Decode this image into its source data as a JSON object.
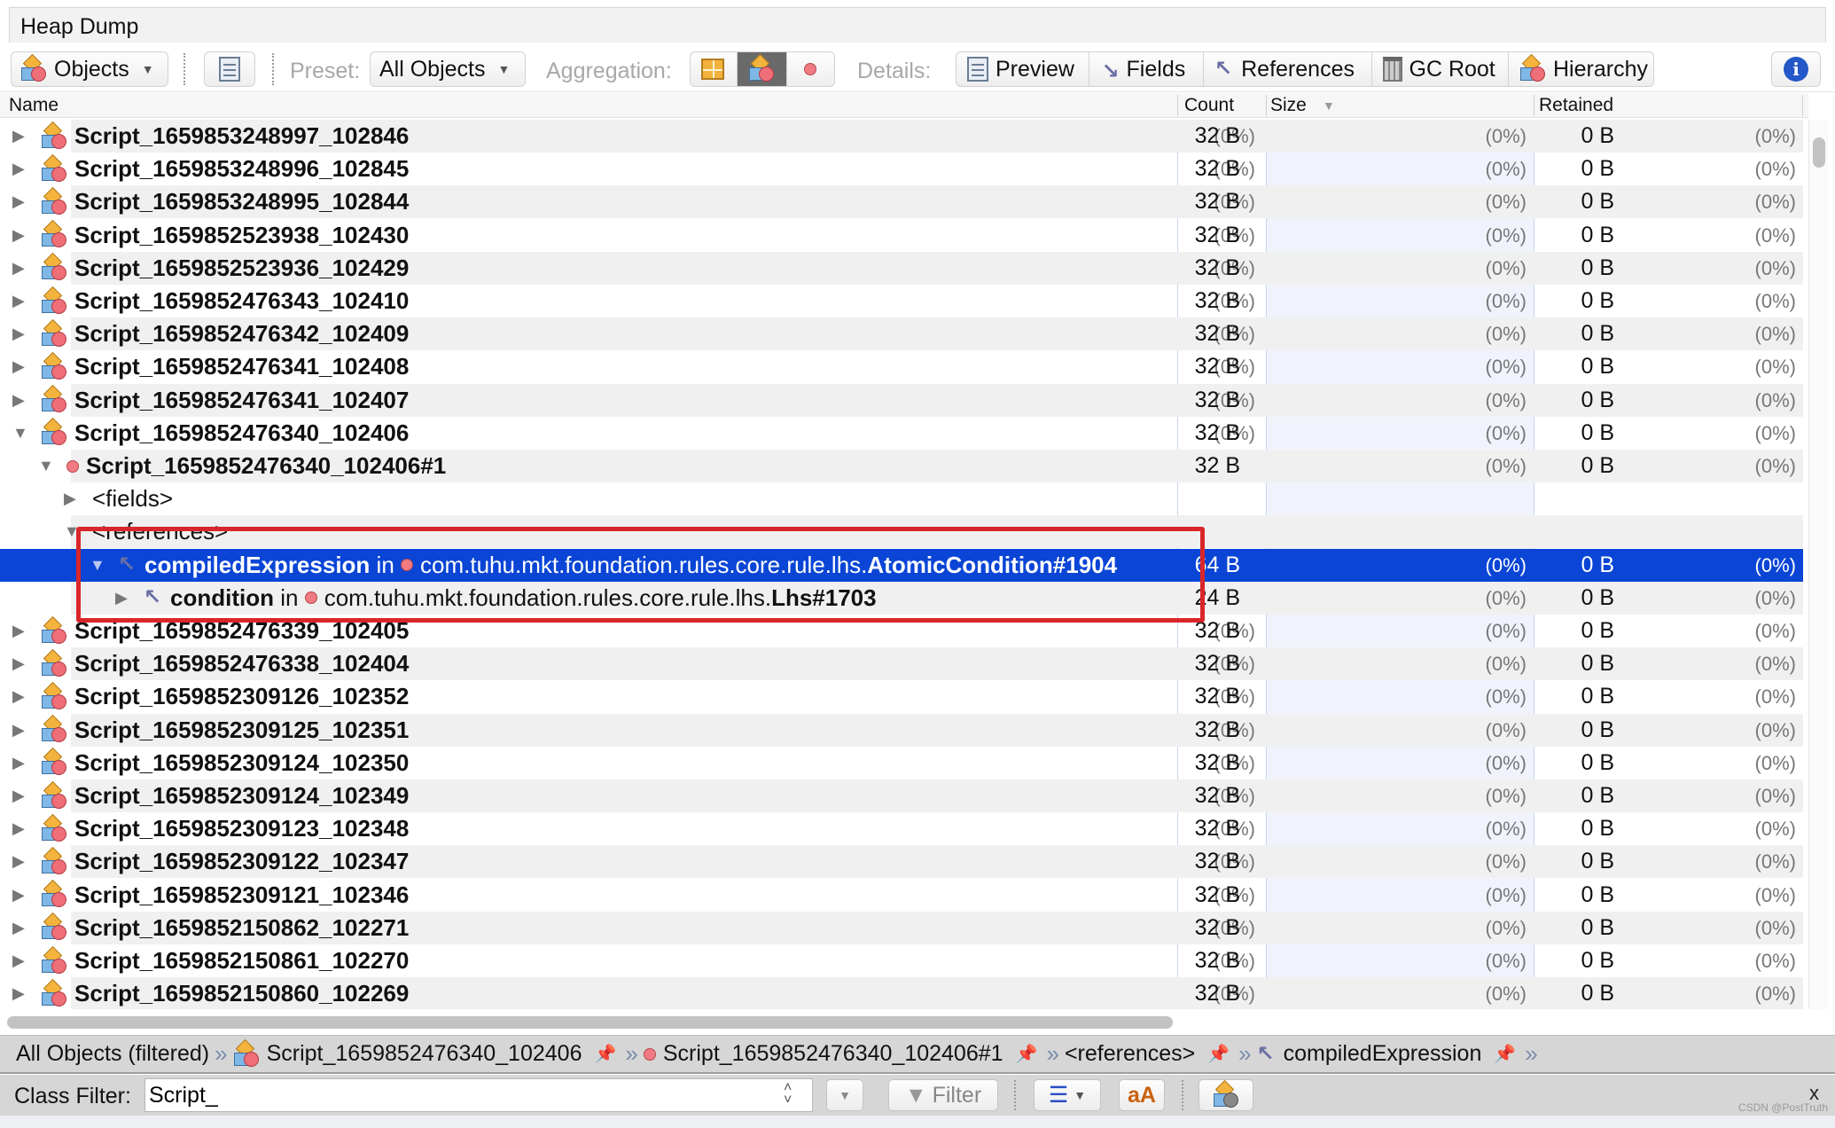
{
  "window": {
    "tab_title": "Heap Dump"
  },
  "toolbar": {
    "view_selector": {
      "label": "Objects",
      "icon": "objects-icon"
    },
    "snapshot_button_icon": "snapshot-icon",
    "preset_label": "Preset:",
    "preset_value": "All Objects",
    "aggregation_label": "Aggregation:",
    "aggregation_options": [
      {
        "icon": "packages-icon",
        "selected": false
      },
      {
        "icon": "classes-icon",
        "selected": true
      },
      {
        "icon": "instances-icon",
        "selected": false
      }
    ],
    "details_label": "Details:",
    "details_buttons": [
      {
        "label": "Preview",
        "icon": "preview-icon"
      },
      {
        "label": "Fields",
        "icon": "fields-icon"
      },
      {
        "label": "References",
        "icon": "references-icon"
      },
      {
        "label": "GC Root",
        "icon": "gc-root-icon"
      },
      {
        "label": "Hierarchy",
        "icon": "hierarchy-icon"
      }
    ],
    "info_icon": "info-icon"
  },
  "columns": {
    "name": "Name",
    "count": "Count",
    "size": "Size",
    "retained": "Retained",
    "sort_column": "Size",
    "sort_direction": "descending"
  },
  "rows": [
    {
      "type": "class",
      "name": "Script_1659853248997_102846",
      "count_pct": "(0%)",
      "size": "32 B",
      "size_pct": "(0%)",
      "retained": "0 B",
      "retained_pct": "(0%)",
      "expanded": false
    },
    {
      "type": "class",
      "name": "Script_1659853248996_102845",
      "count_pct": "(0%)",
      "size": "32 B",
      "size_pct": "(0%)",
      "retained": "0 B",
      "retained_pct": "(0%)",
      "expanded": false
    },
    {
      "type": "class",
      "name": "Script_1659853248995_102844",
      "count_pct": "(0%)",
      "size": "32 B",
      "size_pct": "(0%)",
      "retained": "0 B",
      "retained_pct": "(0%)",
      "expanded": false
    },
    {
      "type": "class",
      "name": "Script_1659852523938_102430",
      "count_pct": "(0%)",
      "size": "32 B",
      "size_pct": "(0%)",
      "retained": "0 B",
      "retained_pct": "(0%)",
      "expanded": false
    },
    {
      "type": "class",
      "name": "Script_1659852523936_102429",
      "count_pct": "(0%)",
      "size": "32 B",
      "size_pct": "(0%)",
      "retained": "0 B",
      "retained_pct": "(0%)",
      "expanded": false
    },
    {
      "type": "class",
      "name": "Script_1659852476343_102410",
      "count_pct": "(0%)",
      "size": "32 B",
      "size_pct": "(0%)",
      "retained": "0 B",
      "retained_pct": "(0%)",
      "expanded": false
    },
    {
      "type": "class",
      "name": "Script_1659852476342_102409",
      "count_pct": "(0%)",
      "size": "32 B",
      "size_pct": "(0%)",
      "retained": "0 B",
      "retained_pct": "(0%)",
      "expanded": false
    },
    {
      "type": "class",
      "name": "Script_1659852476341_102408",
      "count_pct": "(0%)",
      "size": "32 B",
      "size_pct": "(0%)",
      "retained": "0 B",
      "retained_pct": "(0%)",
      "expanded": false
    },
    {
      "type": "class",
      "name": "Script_1659852476341_102407",
      "count_pct": "(0%)",
      "size": "32 B",
      "size_pct": "(0%)",
      "retained": "0 B",
      "retained_pct": "(0%)",
      "expanded": false
    },
    {
      "type": "class",
      "name": "Script_1659852476340_102406",
      "count_pct": "(0%)",
      "size": "32 B",
      "size_pct": "(0%)",
      "retained": "0 B",
      "retained_pct": "(0%)",
      "expanded": true
    },
    {
      "type": "instance",
      "name": "Script_1659852476340_102406#1",
      "count_pct": "",
      "size": "32 B",
      "size_pct": "(0%)",
      "retained": "0 B",
      "retained_pct": "(0%)",
      "expanded": true
    },
    {
      "type": "group",
      "name": "<fields>",
      "count_pct": "",
      "size": "",
      "size_pct": "",
      "retained": "",
      "retained_pct": "",
      "expanded": false
    },
    {
      "type": "group",
      "name": "<references>",
      "count_pct": "",
      "size": "",
      "size_pct": "",
      "retained": "",
      "retained_pct": "",
      "expanded": true
    },
    {
      "type": "reference",
      "field": "compiledExpression",
      "in_label": "in",
      "owner_prefix": "com.tuhu.mkt.foundation.rules.core.rule.lhs.",
      "owner_class": "AtomicCondition#1904",
      "count_pct": "",
      "size": "64 B",
      "size_pct": "(0%)",
      "retained": "0 B",
      "retained_pct": "(0%)",
      "expanded": true,
      "selected": true
    },
    {
      "type": "reference",
      "field": "condition",
      "in_label": "in",
      "owner_prefix": "com.tuhu.mkt.foundation.rules.core.rule.lhs.",
      "owner_class": "Lhs#1703",
      "count_pct": "",
      "size": "24 B",
      "size_pct": "(0%)",
      "retained": "0 B",
      "retained_pct": "(0%)",
      "expanded": false
    },
    {
      "type": "class",
      "name": "Script_1659852476339_102405",
      "count_pct": "(0%)",
      "size": "32 B",
      "size_pct": "(0%)",
      "retained": "0 B",
      "retained_pct": "(0%)",
      "expanded": false
    },
    {
      "type": "class",
      "name": "Script_1659852476338_102404",
      "count_pct": "(0%)",
      "size": "32 B",
      "size_pct": "(0%)",
      "retained": "0 B",
      "retained_pct": "(0%)",
      "expanded": false
    },
    {
      "type": "class",
      "name": "Script_1659852309126_102352",
      "count_pct": "(0%)",
      "size": "32 B",
      "size_pct": "(0%)",
      "retained": "0 B",
      "retained_pct": "(0%)",
      "expanded": false
    },
    {
      "type": "class",
      "name": "Script_1659852309125_102351",
      "count_pct": "(0%)",
      "size": "32 B",
      "size_pct": "(0%)",
      "retained": "0 B",
      "retained_pct": "(0%)",
      "expanded": false
    },
    {
      "type": "class",
      "name": "Script_1659852309124_102350",
      "count_pct": "(0%)",
      "size": "32 B",
      "size_pct": "(0%)",
      "retained": "0 B",
      "retained_pct": "(0%)",
      "expanded": false
    },
    {
      "type": "class",
      "name": "Script_1659852309124_102349",
      "count_pct": "(0%)",
      "size": "32 B",
      "size_pct": "(0%)",
      "retained": "0 B",
      "retained_pct": "(0%)",
      "expanded": false
    },
    {
      "type": "class",
      "name": "Script_1659852309123_102348",
      "count_pct": "(0%)",
      "size": "32 B",
      "size_pct": "(0%)",
      "retained": "0 B",
      "retained_pct": "(0%)",
      "expanded": false
    },
    {
      "type": "class",
      "name": "Script_1659852309122_102347",
      "count_pct": "(0%)",
      "size": "32 B",
      "size_pct": "(0%)",
      "retained": "0 B",
      "retained_pct": "(0%)",
      "expanded": false
    },
    {
      "type": "class",
      "name": "Script_1659852309121_102346",
      "count_pct": "(0%)",
      "size": "32 B",
      "size_pct": "(0%)",
      "retained": "0 B",
      "retained_pct": "(0%)",
      "expanded": false
    },
    {
      "type": "class",
      "name": "Script_1659852150862_102271",
      "count_pct": "(0%)",
      "size": "32 B",
      "size_pct": "(0%)",
      "retained": "0 B",
      "retained_pct": "(0%)",
      "expanded": false
    },
    {
      "type": "class",
      "name": "Script_1659852150861_102270",
      "count_pct": "(0%)",
      "size": "32 B",
      "size_pct": "(0%)",
      "retained": "0 B",
      "retained_pct": "(0%)",
      "expanded": false
    },
    {
      "type": "class",
      "name": "Script_1659852150860_102269",
      "count_pct": "(0%)",
      "size": "32 B",
      "size_pct": "(0%)",
      "retained": "0 B",
      "retained_pct": "(0%)",
      "expanded": false
    }
  ],
  "breadcrumb": [
    {
      "label": "All Objects (filtered)",
      "icon": "",
      "pin": false
    },
    {
      "label": "Script_1659852476340_102406",
      "icon": "class-icon",
      "pin": true
    },
    {
      "label": "Script_1659852476340_102406#1",
      "icon": "instance-icon",
      "pin": true
    },
    {
      "label": "<references>",
      "icon": "",
      "pin": true
    },
    {
      "label": "compiledExpression",
      "icon": "reference-icon",
      "pin": true
    }
  ],
  "filter": {
    "label": "Class Filter:",
    "value": "Script_",
    "filter_button": "Filter",
    "close": "x"
  },
  "watermark": "CSDN @PostTruth",
  "colors": {
    "selection": "#0a45d6",
    "highlight_box": "#d9262a"
  }
}
